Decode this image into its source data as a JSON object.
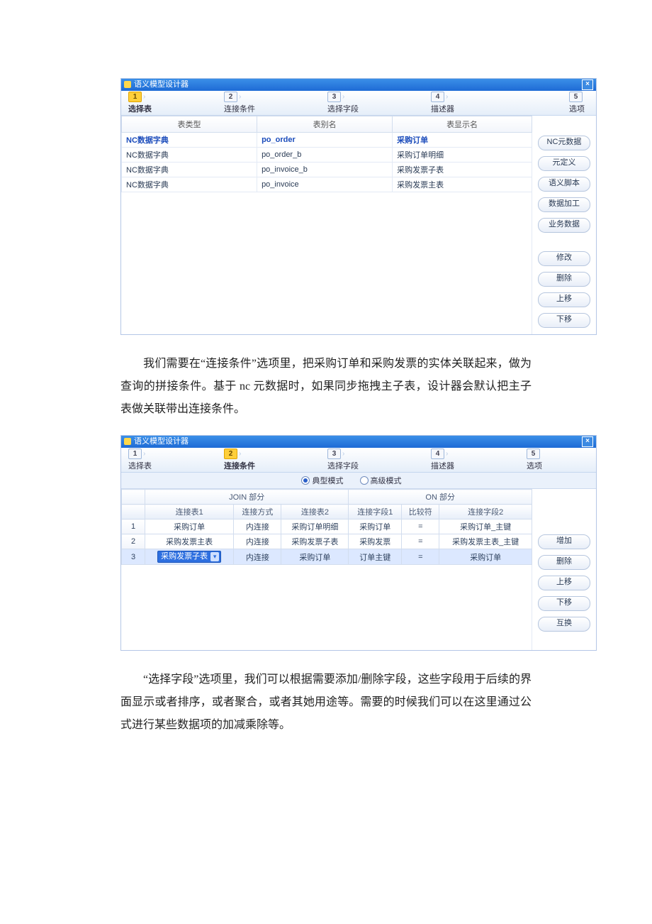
{
  "title": "语义模型设计器",
  "steps": [
    {
      "num": "1",
      "label": "选择表"
    },
    {
      "num": "2",
      "label": "连接条件"
    },
    {
      "num": "3",
      "label": "选择字段"
    },
    {
      "num": "4",
      "label": "描述器"
    },
    {
      "num": "5",
      "label": "选项"
    }
  ],
  "screen1": {
    "active_step": 0,
    "headers": {
      "type": "表类型",
      "alias": "表别名",
      "display": "表显示名"
    },
    "rows": [
      {
        "type": "NC数据字典",
        "alias": "po_order",
        "display": "采购订单"
      },
      {
        "type": "NC数据字典",
        "alias": "po_order_b",
        "display": "采购订单明细"
      },
      {
        "type": "NC数据字典",
        "alias": "po_invoice_b",
        "display": "采购发票子表"
      },
      {
        "type": "NC数据字典",
        "alias": "po_invoice",
        "display": "采购发票主表"
      }
    ],
    "buttons_group1": [
      "NC元数据",
      "元定义",
      "语义脚本",
      "数据加工",
      "业务数据"
    ],
    "buttons_group2": [
      "修改",
      "删除",
      "上移",
      "下移"
    ]
  },
  "para1": "我们需要在“连接条件”选项里，把采购订单和采购发票的实体关联起来，做为查询的拼接条件。基于 nc 元数据时，如果同步拖拽主子表，设计器会默认把主子表做关联带出连接条件。",
  "screen2": {
    "active_step": 1,
    "mode": {
      "typical": "典型模式",
      "advanced": "高级模式"
    },
    "group_join": "JOIN 部分",
    "group_on": "ON 部分",
    "headers2": {
      "t1": "连接表1",
      "mth": "连接方式",
      "t2": "连接表2",
      "f1": "连接字段1",
      "op": "比较符",
      "f2": "连接字段2"
    },
    "rows": [
      {
        "n": "1",
        "t1": "采购订单",
        "mth": "内连接",
        "t2": "采购订单明细",
        "f1": "采购订单",
        "op": "=",
        "f2": "采购订单_主键"
      },
      {
        "n": "2",
        "t1": "采购发票主表",
        "mth": "内连接",
        "t2": "采购发票子表",
        "f1": "采购发票",
        "op": "=",
        "f2": "采购发票主表_主键"
      },
      {
        "n": "3",
        "t1": "采购发票子表",
        "mth": "内连接",
        "t2": "采购订单",
        "f1": "订单主键",
        "op": "=",
        "f2": "采购订单"
      }
    ],
    "buttons": [
      "增加",
      "删除",
      "上移",
      "下移",
      "互换"
    ]
  },
  "para2": "“选择字段”选项里，我们可以根据需要添加/删除字段，这些字段用于后续的界面显示或者排序，或者聚合，或者其她用途等。需要的时候我们可以在这里通过公式进行某些数据项的加减乘除等。"
}
